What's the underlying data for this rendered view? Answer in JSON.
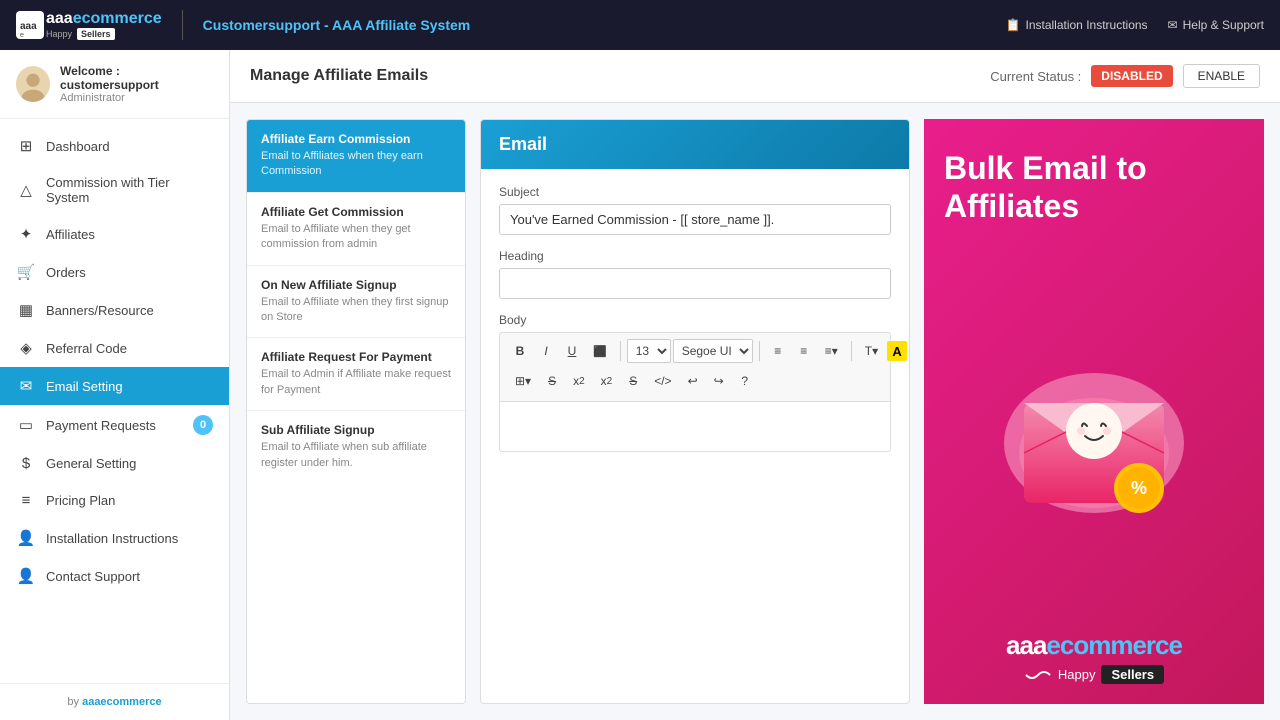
{
  "topbar": {
    "logo_main": "aaa",
    "logo_accent": "ecommerce",
    "logo_sub": "Happy",
    "logo_badge": "Sellers",
    "title": "Customersupport - AAA Affiliate System",
    "links": [
      {
        "icon": "📋",
        "label": "Installation Instructions"
      },
      {
        "icon": "✉",
        "label": "Help & Support"
      }
    ],
    "external_icon": "⊡"
  },
  "sidebar": {
    "user": {
      "welcome": "Welcome : customersupport",
      "role": "Administrator"
    },
    "nav_items": [
      {
        "id": "dashboard",
        "icon": "⊞",
        "label": "Dashboard",
        "active": false
      },
      {
        "id": "commission-tier",
        "icon": "△",
        "label": "Commission with Tier System",
        "active": false
      },
      {
        "id": "affiliates",
        "icon": "✦",
        "label": "Affiliates",
        "active": false
      },
      {
        "id": "orders",
        "icon": "🛒",
        "label": "Orders",
        "active": false
      },
      {
        "id": "banners",
        "icon": "🖼",
        "label": "Banners/Resource",
        "active": false
      },
      {
        "id": "referral",
        "icon": "💎",
        "label": "Referral Code",
        "active": false
      },
      {
        "id": "email-setting",
        "icon": "✉",
        "label": "Email Setting",
        "active": true
      },
      {
        "id": "payment-requests",
        "icon": "💳",
        "label": "Payment Requests",
        "active": false,
        "badge": "0"
      },
      {
        "id": "general-setting",
        "icon": "$",
        "label": "General Setting",
        "active": false
      },
      {
        "id": "pricing-plan",
        "icon": "≡",
        "label": "Pricing Plan",
        "active": false
      },
      {
        "id": "installation",
        "icon": "👤",
        "label": "Installation Instructions",
        "active": false
      },
      {
        "id": "contact-support",
        "icon": "👤",
        "label": "Contact Support",
        "active": false
      }
    ],
    "footer_text": "by ",
    "footer_link": "aaaecommerce"
  },
  "page": {
    "title": "Manage Affiliate Emails",
    "current_status_label": "Current Status :",
    "status": "DISABLED",
    "enable_btn": "ENABLE"
  },
  "email_list": {
    "items": [
      {
        "id": "earn-commission",
        "title": "Affiliate Earn Commission",
        "desc": "Email to Affiliates when they earn Commission",
        "active": true
      },
      {
        "id": "get-commission",
        "title": "Affiliate Get Commission",
        "desc": "Email to Affiliate when they get commission from admin",
        "active": false
      },
      {
        "id": "new-signup",
        "title": "On New Affiliate Signup",
        "desc": "Email to Affiliate when they first signup on Store",
        "active": false
      },
      {
        "id": "request-payment",
        "title": "Affiliate Request For Payment",
        "desc": "Email to Admin if Affiliate make request for Payment",
        "active": false
      },
      {
        "id": "sub-affiliate",
        "title": "Sub Affiliate Signup",
        "desc": "Email to Affiliate when sub affiliate register under him.",
        "active": false
      }
    ]
  },
  "email_form": {
    "header": "Email",
    "subject_label": "Subject",
    "subject_value": "You've Earned Commission - [[ store_name ]].",
    "heading_label": "Heading",
    "heading_value": "",
    "body_label": "Body",
    "toolbar": {
      "bold": "B",
      "italic": "I",
      "underline": "U",
      "strikethrough": "S",
      "font_size": "13",
      "font_family": "Segoe UI",
      "unordered_list": "☰",
      "ordered_list": "≡",
      "align": "≡",
      "text_format": "T↓",
      "highlight": "A",
      "table": "⊞",
      "superscript": "x²",
      "subscript": "x₂",
      "strikethrough2": "S̶",
      "code": "</>",
      "undo": "↩",
      "redo": "↪",
      "help": "?"
    }
  },
  "right_panel": {
    "title_line1": "Bulk Email to",
    "title_line2": "Affiliates",
    "brand_prefix": "aaa",
    "brand_main": "ecommerce",
    "brand_sub": "Happy",
    "brand_sellers": "Sellers"
  }
}
